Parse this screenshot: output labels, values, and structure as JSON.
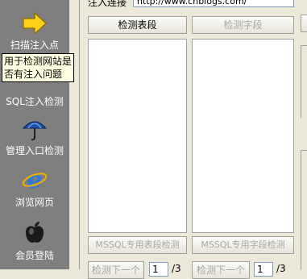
{
  "sidebar": {
    "items": [
      {
        "label": "扫描注入点",
        "icon": "arrow-right-icon"
      },
      {
        "label": "SQL注入检测",
        "icon": "syringe-icon"
      },
      {
        "label": "管理入口检测",
        "icon": "umbrella-icon"
      },
      {
        "label": "浏览网页",
        "icon": "ie-browser-icon"
      },
      {
        "label": "会员登陆",
        "icon": "apple-icon"
      }
    ],
    "tooltip": "用于检测网站是否有注入问题"
  },
  "header": {
    "url_label": "注入连接",
    "url_value": "http://www.cnblogs.com/"
  },
  "panels": {
    "table_button": "检测表段",
    "field_button": "检测字段",
    "mssql_table_button": "MSSQL专用表段检测",
    "mssql_field_button": "MSSQL专用字段检测",
    "next_table_button": "检测下一个",
    "next_field_button": "检测下一个",
    "table_page_value": "1",
    "field_page_value": "1",
    "table_page_sep": "/3",
    "field_page_sep": "/3"
  },
  "colors": {
    "sidebar_bg": "#7f7f7f",
    "window_bg": "#ece9d8",
    "tooltip_bg": "#ffffe1"
  }
}
